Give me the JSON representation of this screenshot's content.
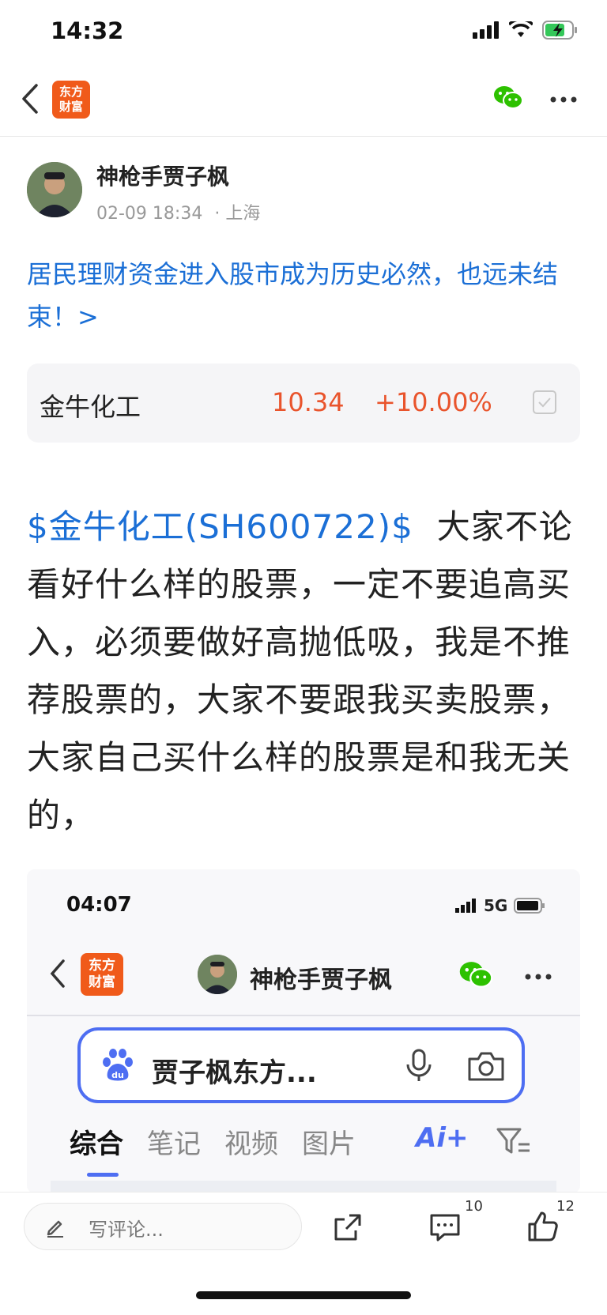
{
  "status_bar": {
    "time": "14:32"
  },
  "nav": {
    "logo_line1": "东方",
    "logo_line2": "财富"
  },
  "author": {
    "name": "神枪手贾子枫",
    "date": "02-09 18:34",
    "location": "· 上海"
  },
  "post": {
    "title": "居民理财资金进入股市成为历史必然，也远未结束！>",
    "stock_tag": "$金牛化工(SH600722)$",
    "body": "大家不论看好什么样的股票，一定不要追高买入，必须要做好高抛低吸，我是不推荐股票的，大家不要跟我买卖股票，大家自己买什么样的股票是和我无关的，"
  },
  "stock_card": {
    "name": "金牛化工",
    "price": "10.34",
    "change": "+10.00%"
  },
  "embedded_screenshot": {
    "time": "04:07",
    "network": "5G",
    "logo_line1": "东方",
    "logo_line2": "财富",
    "author": "神枪手贾子枫",
    "search_query": "贾子枫东方...",
    "tabs": [
      "综合",
      "笔记",
      "视频",
      "图片"
    ],
    "ai_tab": "Ai+"
  },
  "bottom_bar": {
    "comment_placeholder": "写评论...",
    "comment_count": "10",
    "like_count": "12"
  },
  "colors": {
    "link": "#1b6fd6",
    "up": "#e9542c",
    "brand": "#f05a1a",
    "baidu": "#4e6ef2"
  }
}
